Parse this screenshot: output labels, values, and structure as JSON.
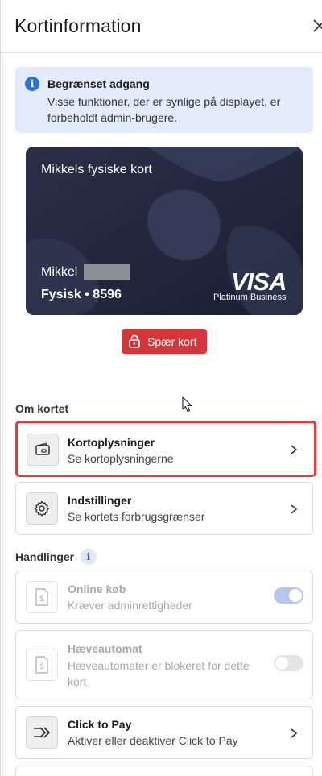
{
  "header": {
    "title": "Kortinformation"
  },
  "alert": {
    "title": "Begrænset adgang",
    "text": "Visse funktioner, der er synlige på displayet, er forbeholdt admin-brugere."
  },
  "card": {
    "name": "Mikkels fysiske kort",
    "holder": "Mikkel",
    "type_line": "Fysisk • 8596",
    "brand": "VISA",
    "brand_sub": "Platinum Business"
  },
  "block_button": {
    "label": "Spær kort"
  },
  "sections": {
    "about": "Om kortet",
    "actions": "Handlinger",
    "actions_info_glyph": "i"
  },
  "about_items": [
    {
      "title": "Kortoplysninger",
      "subtitle": "Se kortoplysningerne",
      "icon": "card-wallet-icon"
    },
    {
      "title": "Indstillinger",
      "subtitle": "Se kortets forbrugsgrænser",
      "icon": "gear-icon"
    }
  ],
  "action_items": [
    {
      "title": "Online køb",
      "subtitle": "Kræver adminrettigheder",
      "icon": "dollar-document-icon",
      "toggle_on": true,
      "disabled": true
    },
    {
      "title": "Hæveautomat",
      "subtitle": "Hæveautomater er blokeret for dette kort",
      "icon": "dollar-document-icon",
      "toggle_on": false,
      "disabled": true
    },
    {
      "title": "Click to Pay",
      "subtitle": "Aktiver eller deaktiver Click to Pay",
      "icon": "click-to-pay-icon"
    }
  ],
  "colors": {
    "accent_blue": "#2f6fd6",
    "danger_red": "#d6353c",
    "highlight_red": "#e23b3b",
    "card_bg": "#242841",
    "toggle_on_disabled": "#b4c8ee",
    "toggle_off_disabled": "#e4e4e4"
  }
}
